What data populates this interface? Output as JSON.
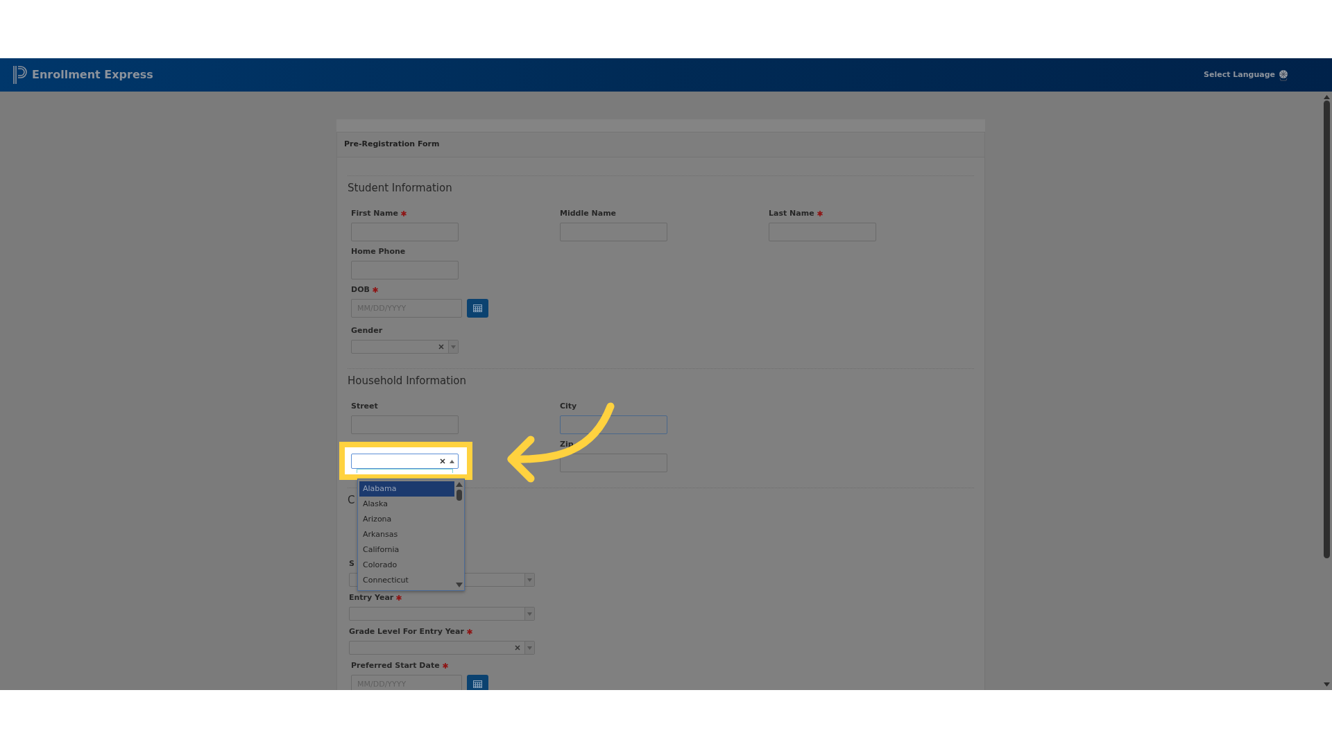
{
  "header": {
    "title": "Enrollment Express",
    "language_link": "Select Language"
  },
  "form": {
    "title": "Pre-Registration Form",
    "sections": [
      {
        "heading": "Student Information",
        "rows": [
          [
            {
              "kind": "text",
              "label": "First Name",
              "required": true
            },
            {
              "kind": "text",
              "label": "Middle Name",
              "required": false
            },
            {
              "kind": "text",
              "label": "Last Name",
              "required": true
            }
          ],
          [
            {
              "kind": "text",
              "label": "Home Phone",
              "required": false
            }
          ],
          [
            {
              "kind": "date",
              "label": "DOB",
              "required": true,
              "placeholder": "MM/DD/YYYY"
            }
          ],
          [
            {
              "kind": "select",
              "label": "Gender",
              "required": false,
              "clearable": true
            }
          ]
        ]
      },
      {
        "heading": "Household Information",
        "rows": [
          [
            {
              "kind": "text",
              "label": "Street",
              "required": false
            },
            {
              "kind": "text",
              "label": "City",
              "required": false,
              "focused": true
            }
          ],
          [
            {
              "kind": "open-select",
              "clearable": true,
              "highlighted": true,
              "options": [
                {
                  "label": "Alabama",
                  "selected": true
                },
                {
                  "label": "Alaska",
                  "selected": false
                },
                {
                  "label": "Arizona",
                  "selected": false
                },
                {
                  "label": "Arkansas",
                  "selected": false
                },
                {
                  "label": "California",
                  "selected": false
                },
                {
                  "label": "Colorado",
                  "selected": false
                },
                {
                  "label": "Connecticut",
                  "selected": false
                }
              ]
            },
            {
              "kind": "text",
              "label": "Zip",
              "required": false
            }
          ]
        ]
      },
      {
        "heading": "C",
        "rows": [
          [
            {
              "kind": "wide-select",
              "label": "S",
              "required": false
            }
          ],
          [
            {
              "kind": "wide-select",
              "label": "Entry Year",
              "required": true
            }
          ],
          [
            {
              "kind": "wide-select",
              "label": "Grade Level For Entry Year",
              "required": true,
              "clearable": true
            }
          ],
          [
            {
              "kind": "date",
              "label": "Preferred Start Date",
              "required": true,
              "placeholder": "MM/DD/YYYY"
            }
          ]
        ]
      }
    ]
  }
}
